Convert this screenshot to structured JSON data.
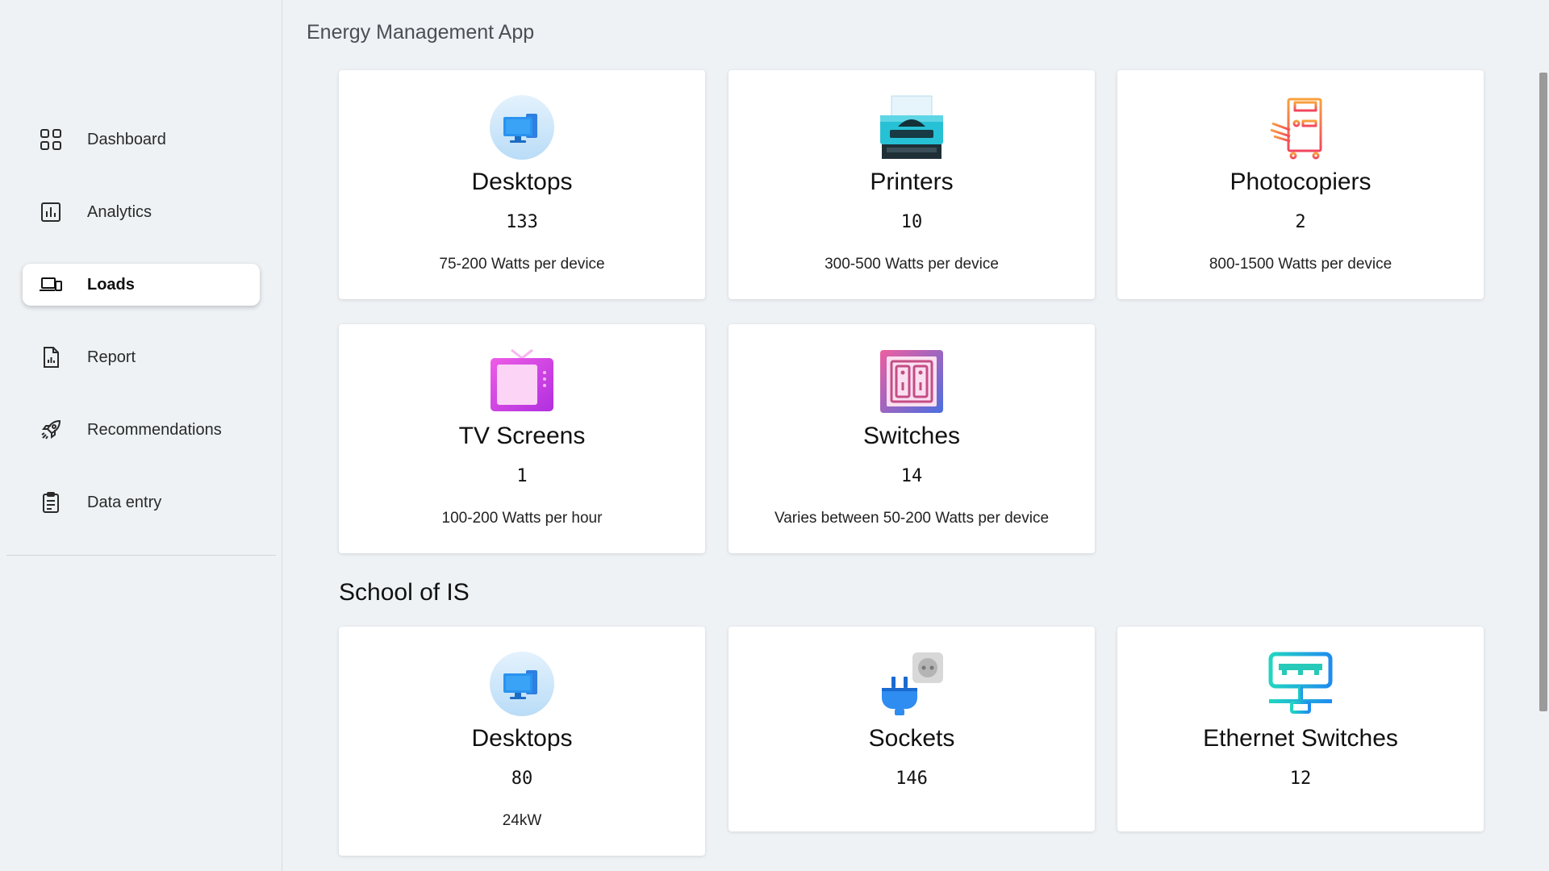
{
  "app": {
    "title": "Energy Management App"
  },
  "sidebar": {
    "items": [
      {
        "label": "Dashboard",
        "icon": "dashboard-icon",
        "active": false
      },
      {
        "label": "Analytics",
        "icon": "analytics-icon",
        "active": false
      },
      {
        "label": "Loads",
        "icon": "loads-icon",
        "active": true
      },
      {
        "label": "Report",
        "icon": "report-icon",
        "active": false
      },
      {
        "label": "Recommendations",
        "icon": "rocket-icon",
        "active": false
      },
      {
        "label": "Data entry",
        "icon": "clipboard-icon",
        "active": false
      }
    ]
  },
  "loads": [
    {
      "name": "Desktops",
      "count": "133",
      "desc": "75-200 Watts per device",
      "icon": "desktop-icon"
    },
    {
      "name": "Printers",
      "count": "10",
      "desc": "300-500 Watts per device",
      "icon": "printer-icon"
    },
    {
      "name": "Photocopiers",
      "count": "2",
      "desc": "800-1500 Watts per device",
      "icon": "photocopier-icon"
    },
    {
      "name": "TV Screens",
      "count": "1",
      "desc": "100-200 Watts per hour",
      "icon": "tv-icon"
    },
    {
      "name": "Switches",
      "count": "14",
      "desc": "Varies between 50-200 Watts per device",
      "icon": "switch-icon"
    }
  ],
  "school": {
    "title": "School of IS",
    "items": [
      {
        "name": "Desktops",
        "count": "80",
        "desc": "24kW",
        "icon": "desktop-icon"
      },
      {
        "name": "Sockets",
        "count": "146",
        "desc": "",
        "icon": "socket-icon"
      },
      {
        "name": "Ethernet Switches",
        "count": "12",
        "desc": "",
        "icon": "ethernet-switch-icon"
      }
    ]
  },
  "colors": {
    "background": "#eef2f5",
    "card": "#ffffff",
    "accent_blue": "#2f8cf0"
  }
}
